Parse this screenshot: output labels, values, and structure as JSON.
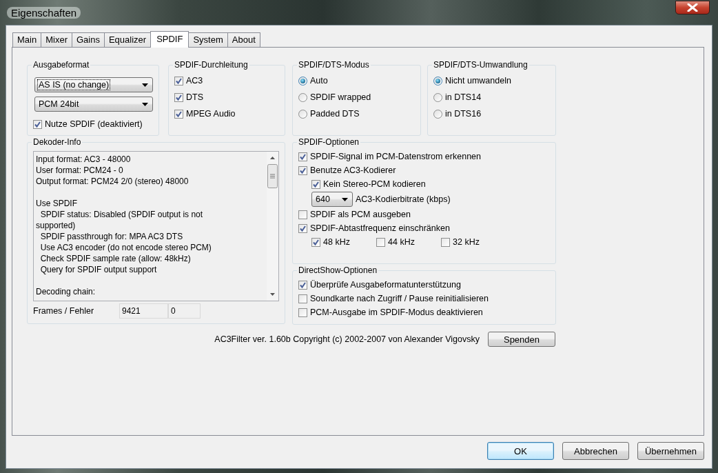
{
  "window": {
    "title": "Eigenschaften"
  },
  "tabs": [
    {
      "label": "Main",
      "selected": false
    },
    {
      "label": "Mixer",
      "selected": false
    },
    {
      "label": "Gains",
      "selected": false
    },
    {
      "label": "Equalizer",
      "selected": false
    },
    {
      "label": "SPDIF",
      "selected": true
    },
    {
      "label": "System",
      "selected": false
    },
    {
      "label": "About",
      "selected": false
    }
  ],
  "output_format": {
    "title": "Ausgabeformat",
    "dropdowns": [
      {
        "value": "AS IS (no change)",
        "focused": true
      },
      {
        "value": "PCM 24bit",
        "focused": false
      }
    ],
    "checkbox": {
      "label": "Nutze SPDIF (deaktiviert)",
      "checked": true
    }
  },
  "passthrough": {
    "title": "SPDIF-Durchleitung",
    "options": [
      {
        "label": "AC3",
        "checked": true
      },
      {
        "label": "DTS",
        "checked": true
      },
      {
        "label": "MPEG Audio",
        "checked": true
      }
    ]
  },
  "dts_mode": {
    "title": "SPDIF/DTS-Modus",
    "options": [
      {
        "label": "Auto",
        "selected": true
      },
      {
        "label": "SPDIF wrapped",
        "selected": false
      },
      {
        "label": "Padded DTS",
        "selected": false
      }
    ]
  },
  "dts_conversion": {
    "title": "SPDIF/DTS-Umwandlung",
    "options": [
      {
        "label": "Nicht umwandeln",
        "selected": true
      },
      {
        "label": "in DTS14",
        "selected": false
      },
      {
        "label": "in DTS16",
        "selected": false
      }
    ]
  },
  "decoder_info": {
    "title": "Dekoder-Info",
    "paragraphs": [
      [
        "Input format: AC3 - 48000",
        "User format: PCM24 - 0",
        "Output format: PCM24 2/0 (stereo) 48000"
      ],
      [
        "Use SPDIF",
        "  SPDIF status: Disabled (SPDIF output is not supported)",
        "  SPDIF passthrough for: MPA AC3 DTS",
        "  Use AC3 encoder (do not encode stereo PCM)",
        "  Check SPDIF sample rate (allow: 48kHz)",
        "  Query for SPDIF output support"
      ],
      [
        "Decoding chain:"
      ]
    ],
    "counters_label": "Frames / Fehler",
    "frames": "9421",
    "errors": "0"
  },
  "spdif_options": {
    "title": "SPDIF-Optionen",
    "items": [
      {
        "label": "SPDIF-Signal im PCM-Datenstrom erkennen",
        "checked": true
      },
      {
        "label": "Benutze AC3-Kodierer",
        "checked": true,
        "children": [
          {
            "kind": "checkbox",
            "label": "Kein Stereo-PCM kodieren",
            "checked": true
          },
          {
            "kind": "dropdown",
            "value": "640",
            "label": "AC3-Kodierbitrate (kbps)"
          }
        ]
      },
      {
        "label": "SPDIF als PCM ausgeben",
        "checked": false
      },
      {
        "label": "SPDIF-Abtastfrequenz einschränken",
        "checked": true,
        "children": [
          {
            "kind": "checkbox_row",
            "options": [
              {
                "label": "48 kHz",
                "checked": true
              },
              {
                "label": "44 kHz",
                "checked": false
              },
              {
                "label": "32 kHz",
                "checked": false
              }
            ]
          }
        ]
      }
    ]
  },
  "directshow_options": {
    "title": "DirectShow-Optionen",
    "items": [
      {
        "label": "Überprüfe Ausgabeformatunterstützung",
        "checked": true
      },
      {
        "label": "Soundkarte nach Zugriff / Pause reinitialisieren",
        "checked": false
      },
      {
        "label": "PCM-Ausgabe im SPDIF-Modus deaktivieren",
        "checked": false
      }
    ]
  },
  "footer": {
    "copyright": "AC3Filter ver. 1.60b Copyright (c) 2002-2007 von Alexander Vigovsky",
    "donate_button": "Spenden"
  },
  "buttons": [
    {
      "label": "OK",
      "default": true
    },
    {
      "label": "Abbrechen",
      "default": false
    },
    {
      "label": "Übernehmen",
      "default": false
    }
  ]
}
